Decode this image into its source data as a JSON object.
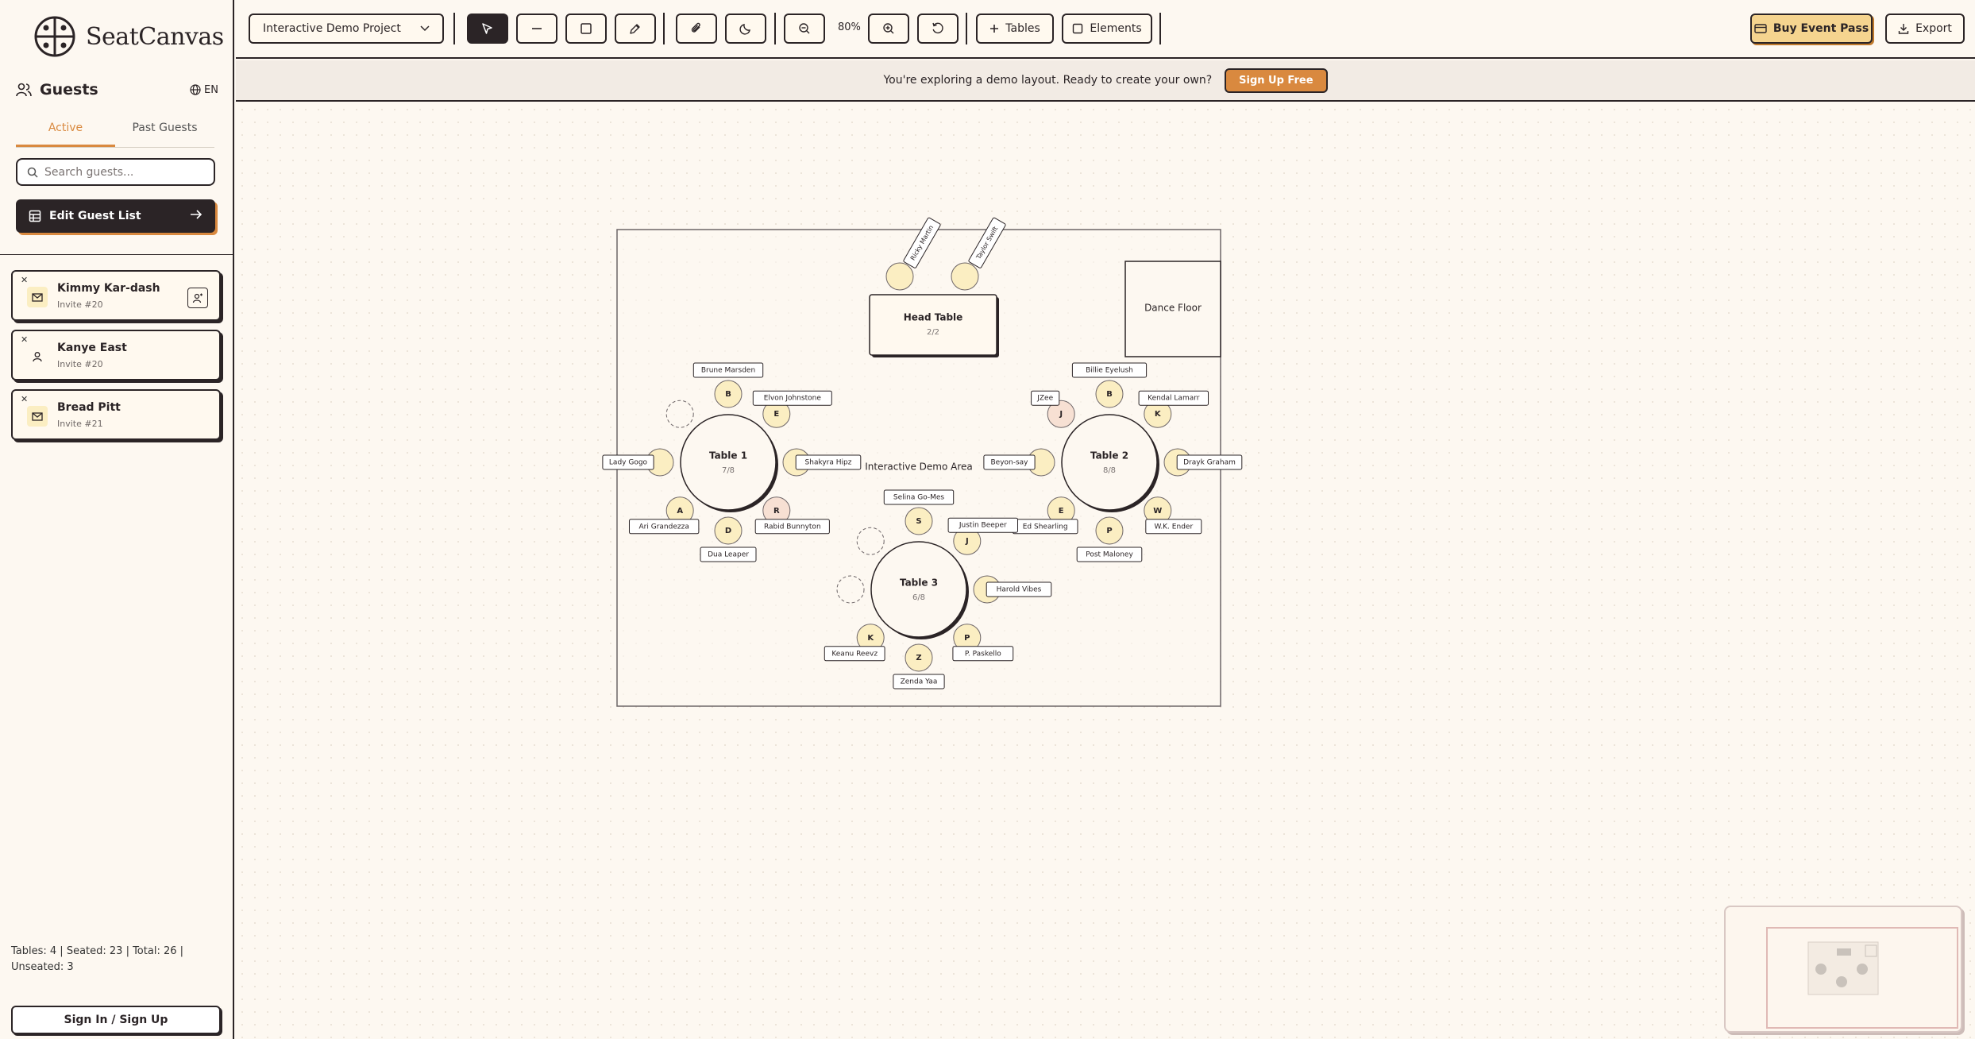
{
  "app": {
    "name": "SeatCanvas"
  },
  "sidebar": {
    "title": "Guests",
    "lang": "EN",
    "tabs": [
      {
        "label": "Active"
      },
      {
        "label": "Past Guests"
      }
    ],
    "search_placeholder": "Search guests...",
    "edit_label": "Edit Guest List",
    "guests": [
      {
        "name": "Kimmy Kar-dash",
        "invite": "Invite #20",
        "icon": "mail-icon"
      },
      {
        "name": "Kanye East",
        "invite": "Invite #20",
        "icon": "person-icon"
      },
      {
        "name": "Bread Pitt",
        "invite": "Invite #21",
        "icon": "mail-icon"
      }
    ],
    "stats": "Tables: 4 | Seated: 23 | Total: 26 | Unseated: 3",
    "signin_label": "Sign In / Sign Up"
  },
  "toolbar": {
    "project": "Interactive Demo Project",
    "zoom": "80%",
    "tables_label": "Tables",
    "elements_label": "Elements",
    "buy_label": "Buy Event Pass",
    "export_label": "Export"
  },
  "banner": {
    "text": "You're exploring a demo layout. Ready to create your own?",
    "cta": "Sign Up Free"
  },
  "canvas": {
    "area_label": "Interactive Demo Area",
    "head_table": {
      "name": "Head Table",
      "count": "2/2",
      "guests": [
        "Ricky Martin",
        "Taylor Swift"
      ]
    },
    "dance_floor": "Dance Floor",
    "tables": [
      {
        "name": "Table 1",
        "count": "7/8",
        "seats": [
          {
            "initial": "B",
            "label": "Brune Marsden"
          },
          {
            "initial": "E",
            "label": "Elvon Johnstone"
          },
          {
            "initial": "",
            "label": "Shakyra Hipz"
          },
          {
            "initial": "R",
            "label": "Rabid Bunnyton"
          },
          {
            "initial": "D",
            "label": "Dua Leaper"
          },
          {
            "initial": "A",
            "label": "Ari Grandezza"
          },
          {
            "initial": "",
            "label": "Lady Gogo"
          },
          {
            "initial": "",
            "label": ""
          }
        ]
      },
      {
        "name": "Table 2",
        "count": "8/8",
        "seats": [
          {
            "initial": "B",
            "label": "Billie Eyelush"
          },
          {
            "initial": "K",
            "label": "Kendal Lamarr"
          },
          {
            "initial": "",
            "label": "Drayk Graham"
          },
          {
            "initial": "W",
            "label": "W.K. Ender"
          },
          {
            "initial": "P",
            "label": "Post Maloney"
          },
          {
            "initial": "E",
            "label": "Ed Shearling"
          },
          {
            "initial": "",
            "label": "Beyon-say"
          },
          {
            "initial": "J",
            "label": "JZee"
          }
        ]
      },
      {
        "name": "Table 3",
        "count": "6/8",
        "seats": [
          {
            "initial": "S",
            "label": "Selina Go-Mes"
          },
          {
            "initial": "J",
            "label": "Justin Beeper"
          },
          {
            "initial": "",
            "label": "Harold Vibes"
          },
          {
            "initial": "P",
            "label": "P. Paskello"
          },
          {
            "initial": "Z",
            "label": "Zenda Yaa"
          },
          {
            "initial": "K",
            "label": "Keanu Reevz"
          },
          {
            "initial": "",
            "label": ""
          },
          {
            "initial": "",
            "label": ""
          }
        ]
      }
    ]
  }
}
